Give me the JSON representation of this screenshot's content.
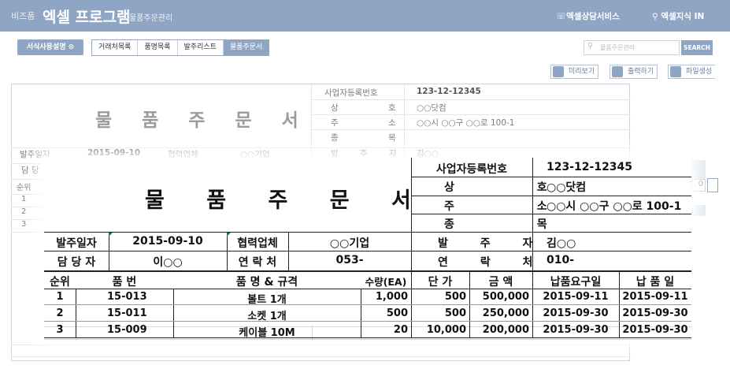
{
  "header": {
    "brand_small": "비즈폼",
    "brand": "엑셀 프로그램",
    "subtitle": "물품주문관리",
    "service": "엑셀상담서비스",
    "knowledge": "엑셀지식 IN"
  },
  "toolbar": {
    "guide_btn": "서식사용설명 ⊙",
    "tabs": [
      "거래처목록",
      "품명목록",
      "발주리스트",
      "물품주문서"
    ],
    "search_placeholder": "물품주문관리",
    "search_btn": "SEARCH",
    "actions": [
      "미리보기",
      "출력하기",
      "파일생성"
    ]
  },
  "doc": {
    "title": "물 품 주 문 서",
    "supplier": {
      "reg_label": "사업자등록번호",
      "reg_value": "123-12-12345",
      "name_label": "상 호",
      "name_value": "○○닷컴",
      "addr_label": "주 소",
      "addr_value": "○○시 ○○구 ○○로 100-1",
      "item_label": "종 목",
      "item_value": "",
      "orderer_label": "발 주 자",
      "orderer_value": "김○○",
      "contact_label": "연 락 처",
      "contact_value": "010-"
    },
    "order_date_label": "발주일자",
    "order_date": "2015-09-10",
    "partner_label": "협력업체",
    "partner": "○○기업",
    "manager_label": "담 당 자",
    "manager": "이○○",
    "partner_contact_label": "연 락 처",
    "partner_contact": "053-",
    "columns": [
      "순위",
      "품 번",
      "품 명 & 규격",
      "수량(EA)",
      "단 가",
      "금 액",
      "납품요구일",
      "납 품 일"
    ],
    "rows": [
      {
        "no": "1",
        "code": "15-013",
        "name": "볼트 1개",
        "qty": "1,000",
        "price": "500",
        "amount": "500,000",
        "req": "2015-09-11",
        "deliv": "2015-09-11"
      },
      {
        "no": "2",
        "code": "15-011",
        "name": "소켓 1개",
        "qty": "500",
        "price": "500",
        "amount": "250,000",
        "req": "2015-09-30",
        "deliv": "2015-09-30"
      },
      {
        "no": "3",
        "code": "15-009",
        "name": "케이블 10M",
        "qty": "20",
        "price": "10,000",
        "amount": "200,000",
        "req": "2015-09-30",
        "deliv": "2015-09-30"
      }
    ],
    "bg_row_labels": [
      "순위",
      "1",
      "2",
      "3"
    ],
    "bg_manager_label": "담 당"
  },
  "colors": {
    "accent": "#8fa5c4"
  }
}
